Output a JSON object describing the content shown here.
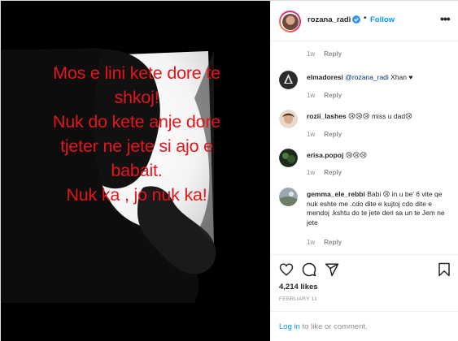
{
  "post": {
    "overlay_lines": [
      "Mos e lini kete dore te",
      "shkoj!",
      "Nuk do kete anje dore",
      "tjeter ne jete si ajo e",
      "babait.",
      "Nuk ka , jo nuk ka!"
    ]
  },
  "header": {
    "username": "rozana_radi",
    "separator": "•",
    "follow_label": "Follow",
    "more_label": "•••"
  },
  "caption_meta": {
    "time": "1w",
    "reply": "Reply"
  },
  "comments": [
    {
      "username": "elmadoresi",
      "mention": "@rozana_radi",
      "text": " Xhan ♥",
      "time": "1w",
      "reply": "Reply"
    },
    {
      "username": "rozii_lashes",
      "text": " 😢😢😢 miss u dad😢",
      "time": "1w",
      "reply": "Reply"
    },
    {
      "username": "erisa.popoj",
      "text": " 😢😢😢",
      "time": "1w",
      "reply": "Reply"
    },
    {
      "username": "gemma_ele_rebbi",
      "text": " Babi 😢 in u be' 6 vite qe nuk eshte me .cdo dite e kujtoj cdo dite e mendoj .kshtu do te jete deri sa un te Jem ne jete",
      "time": "1w",
      "reply": "Reply"
    }
  ],
  "actions": {
    "like_icon": "heart-icon",
    "comment_icon": "comment-icon",
    "share_icon": "share-icon",
    "save_icon": "bookmark-icon"
  },
  "likes": "4,214 likes",
  "date": "FEBRUARY 11",
  "login": {
    "link": "Log in",
    "rest": " to like or comment."
  },
  "colors": {
    "overlay_text": "#e5151b",
    "link_blue": "#0095f6",
    "muted": "#8e8e8e"
  }
}
